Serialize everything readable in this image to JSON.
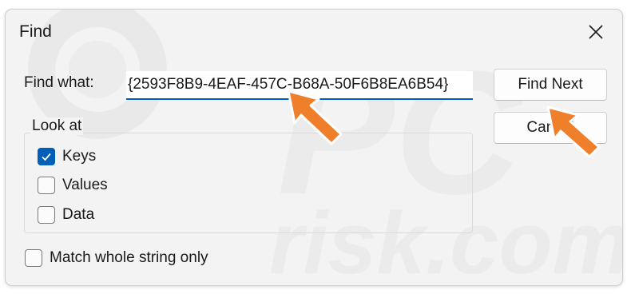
{
  "dialog": {
    "title": "Find",
    "close_icon": "close-icon"
  },
  "find": {
    "label": "Find what:",
    "value": "{2593F8B9-4EAF-457C-B68A-50F6B8EA6B54}"
  },
  "buttons": {
    "find_next": "Find Next",
    "cancel": "Cancel"
  },
  "look_at": {
    "label": "Look at",
    "options": [
      {
        "label": "Keys",
        "checked": true
      },
      {
        "label": "Values",
        "checked": false
      },
      {
        "label": "Data",
        "checked": false
      }
    ]
  },
  "match_whole": {
    "label": "Match whole string only",
    "checked": false
  },
  "colors": {
    "accent": "#005fb8",
    "arrow": "#f07f2c",
    "background": "#f3f3f3"
  },
  "annotation_icons": [
    "orange-arrow-icon",
    "orange-arrow-icon"
  ]
}
